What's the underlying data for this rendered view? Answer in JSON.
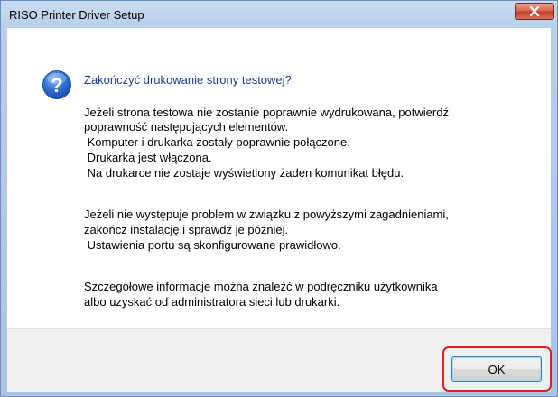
{
  "window": {
    "title": "RISO Printer Driver Setup",
    "close_icon": "close-x-icon"
  },
  "dialog": {
    "icon": "question-mark-icon",
    "heading": "Zakończyć drukowanie strony testowej?",
    "lines": [
      "Jeżeli strona testowa nie zostanie poprawnie wydrukowana, potwierdź",
      "poprawność następujących elementów.",
      " Komputer i drukarka zostały poprawnie połączone.",
      " Drukarka jest włączona.",
      " Na drukarce nie zostaje wyświetlony żaden komunikat błędu.",
      "Jeżeli nie występuje problem w związku z powyższymi zagadnieniami,",
      "zakończ instalację i sprawdź je później.",
      " Ustawienia portu są skonfigurowane prawidłowo.",
      "Szczegółowe informacje można znaleźć w podręczniku użytkownika",
      "albo uzyskać od administratora sieci lub drukarki."
    ]
  },
  "buttons": {
    "ok_label": "OK"
  },
  "colors": {
    "heading": "#1a3e8c",
    "highlight": "#e11f1f"
  }
}
